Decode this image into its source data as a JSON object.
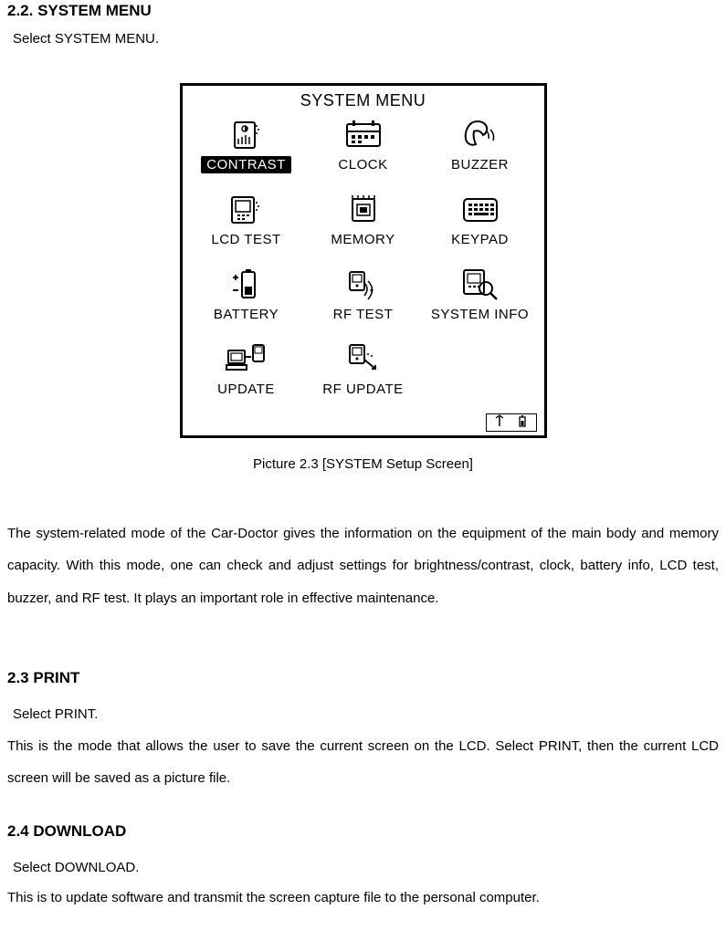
{
  "section1": {
    "heading": "2.2. SYSTEM MENU",
    "select": "Select SYSTEM MENU.",
    "caption": "Picture 2.3 [SYSTEM Setup Screen]",
    "para": "The system-related mode of the Car-Doctor gives the information on the equipment of the main body and memory capacity. With this mode, one can check and adjust settings for brightness/contrast, clock, battery info, LCD test, buzzer, and RF test. It plays an important role in effective maintenance."
  },
  "lcd": {
    "title": "SYSTEM MENU",
    "items": [
      {
        "label": "CONTRAST",
        "selected": true
      },
      {
        "label": "CLOCK",
        "selected": false
      },
      {
        "label": "BUZZER",
        "selected": false
      },
      {
        "label": "LCD TEST",
        "selected": false
      },
      {
        "label": "MEMORY",
        "selected": false
      },
      {
        "label": "KEYPAD",
        "selected": false
      },
      {
        "label": "BATTERY",
        "selected": false
      },
      {
        "label": "RF TEST",
        "selected": false
      },
      {
        "label": "SYSTEM INFO",
        "selected": false
      },
      {
        "label": "UPDATE",
        "selected": false
      },
      {
        "label": "RF UPDATE",
        "selected": false
      }
    ]
  },
  "section2": {
    "heading": "2.3 PRINT",
    "select": "Select PRINT.",
    "para": "This is the mode that allows the user to save the current screen on the LCD. Select PRINT, then the current LCD screen will be saved as a picture file."
  },
  "section3": {
    "heading": "2.4 DOWNLOAD",
    "select": "Select DOWNLOAD.",
    "para": "This is to update software and transmit the screen capture file to the personal computer."
  }
}
